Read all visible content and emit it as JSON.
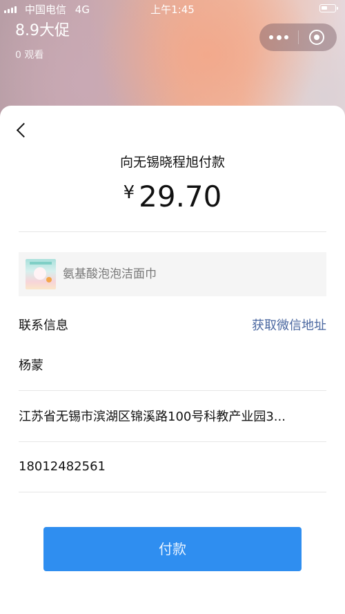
{
  "status_bar": {
    "carrier": "中国电信",
    "network": "4G",
    "time": "上午1:45"
  },
  "live": {
    "title": "8.9大促",
    "viewers": "0 观看"
  },
  "capsule": {
    "more_icon": "more-dots-icon",
    "close_icon": "circle-close-icon"
  },
  "payment": {
    "payee": "向无锡晓程旭付款",
    "currency_symbol": "¥",
    "amount": "29.70"
  },
  "product": {
    "name": "氨基酸泡泡洁面巾"
  },
  "contact": {
    "label": "联系信息",
    "fetch_link": "获取微信地址",
    "name": "杨蒙",
    "address": "江苏省无锡市滨湖区锦溪路100号科教产业园3...",
    "phone": "18012482561"
  },
  "actions": {
    "pay_label": "付款"
  },
  "colors": {
    "pay_button": "#2f8ef0",
    "link": "#4a67a0"
  }
}
